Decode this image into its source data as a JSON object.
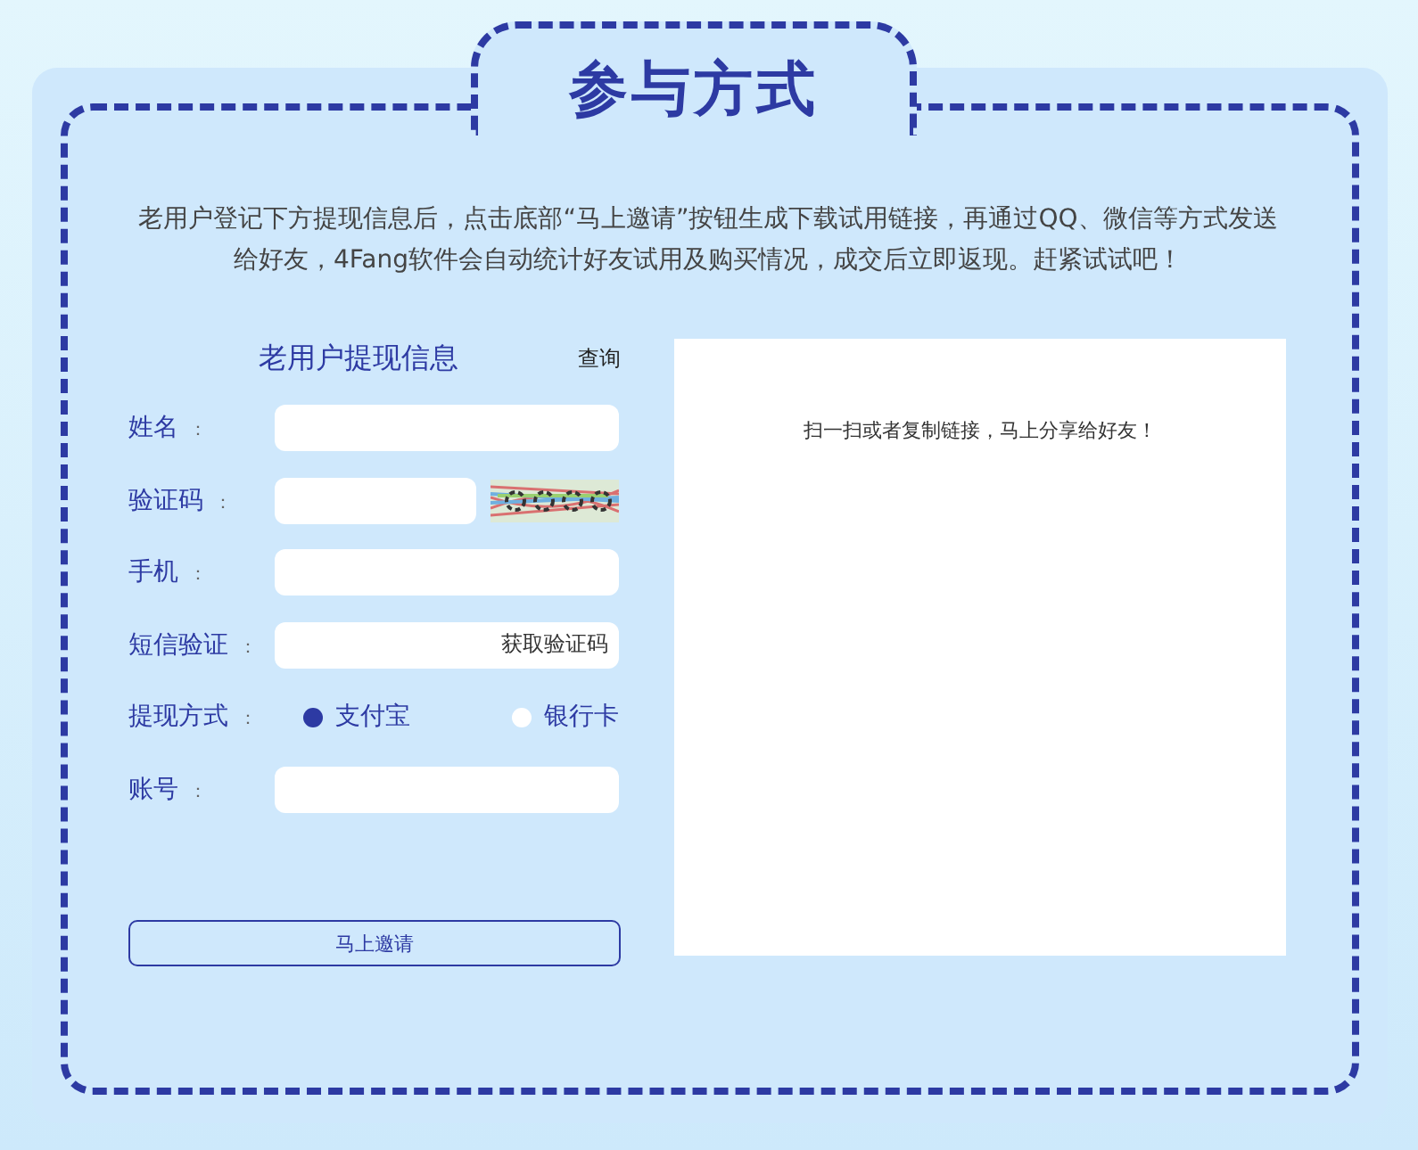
{
  "title": "参与方式",
  "intro": "老用户登记下方提现信息后，点击底部“马上邀请”按钮生成下载试用链接，再通过QQ、微信等方式发送给好友，4Fang软件会自动统计好友试用及购买情况，成交后立即返现。赶紧试试吧！",
  "form": {
    "heading": "老用户提现信息",
    "query_link": "查询",
    "fields": [
      {
        "kind": "text",
        "label": "姓名",
        "colon": "："
      },
      {
        "kind": "captcha",
        "label": "验证码",
        "colon": "："
      },
      {
        "kind": "text",
        "label": "手机",
        "colon": "："
      },
      {
        "kind": "sms",
        "label": "短信验证",
        "colon": "：",
        "button": "获取验证码"
      },
      {
        "kind": "radio",
        "label": "提现方式",
        "colon": "：",
        "options": [
          {
            "label": "支付宝",
            "selected": true
          },
          {
            "label": "银行卡",
            "selected": false
          }
        ]
      },
      {
        "kind": "text",
        "label": "账号",
        "colon": "："
      }
    ],
    "submit": "马上邀请"
  },
  "share_panel": {
    "text": "扫一扫或者复制链接，马上分享给好友！"
  }
}
